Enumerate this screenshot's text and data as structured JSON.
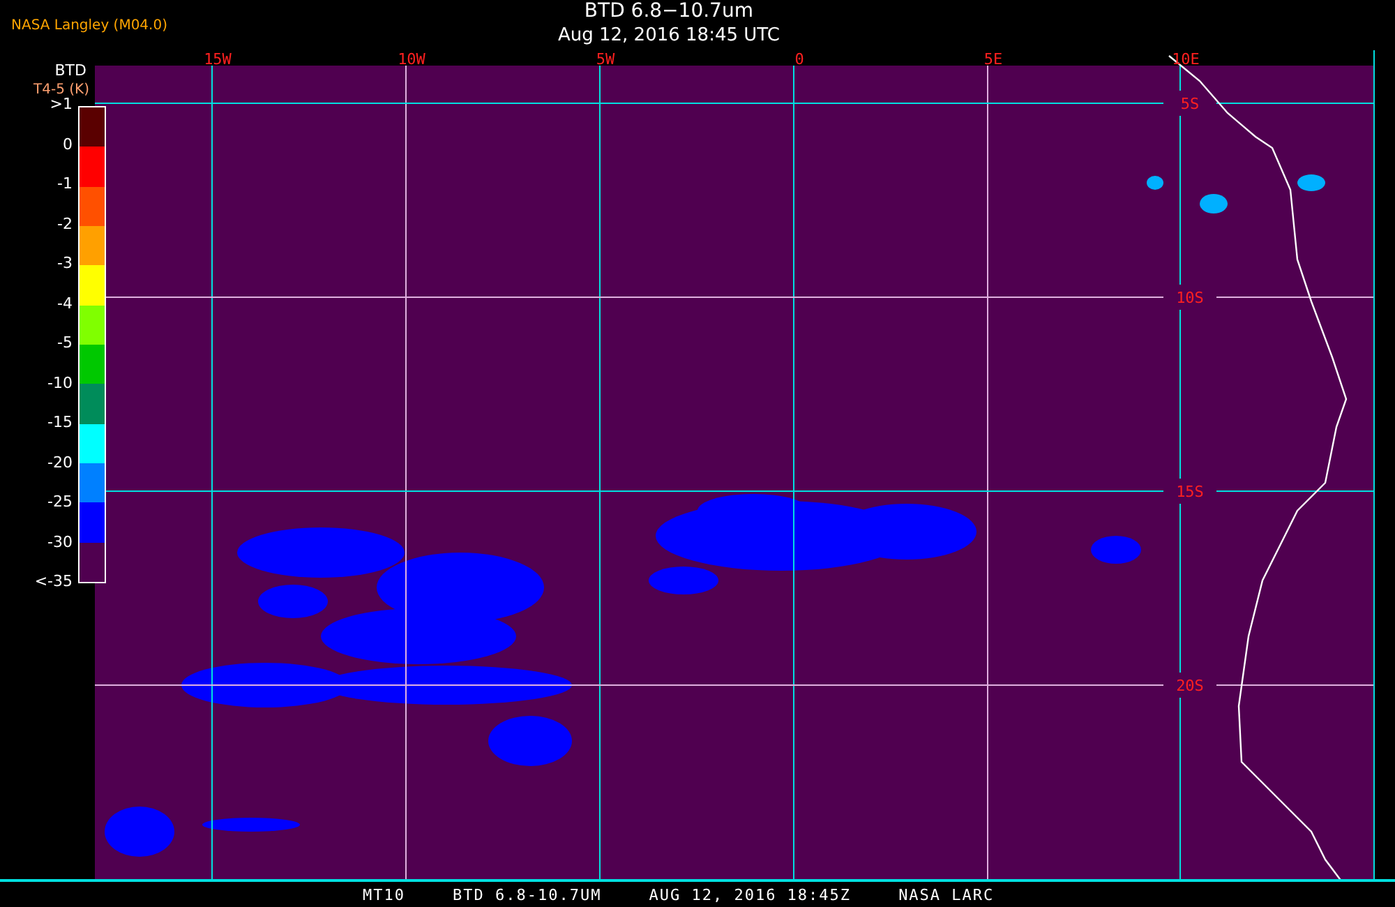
{
  "header": {
    "source": "NASA Langley (M04.0)",
    "title": "BTD 6.8−10.7um",
    "timestamp": "Aug 12, 2016 18:45 UTC"
  },
  "legend": {
    "title": "BTD",
    "units": "T4-5 (K)",
    "ticks": [
      ">1",
      "0",
      "-1",
      "-2",
      "-3",
      "-4",
      "-5",
      "-10",
      "-15",
      "-20",
      "-25",
      "-30",
      "<-35"
    ],
    "bins": [
      {
        "color": "#5a0000"
      },
      {
        "color": "#ff0000"
      },
      {
        "color": "#ff5000"
      },
      {
        "color": "#ffa000"
      },
      {
        "color": "#ffff00"
      },
      {
        "color": "#80ff00"
      },
      {
        "color": "#00c800"
      },
      {
        "color": "#008c5a"
      },
      {
        "color": "#00ffff"
      },
      {
        "color": "#0080ff"
      },
      {
        "color": "#0000ff"
      },
      {
        "color": "#500050"
      }
    ]
  },
  "map": {
    "lon_labels": [
      "15W",
      "10W",
      "5W",
      "0",
      "5E",
      "10E"
    ],
    "lat_labels": [
      "5S",
      "10S",
      "15S",
      "20S"
    ]
  },
  "footer": [
    "MT10",
    "BTD 6.8-10.7UM",
    "AUG 12, 2016 18:45Z",
    "NASA LARC"
  ]
}
